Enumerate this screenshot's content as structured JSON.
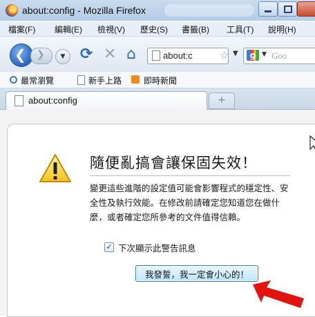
{
  "window": {
    "title": "about:config - Mozilla Firefox"
  },
  "menu": {
    "items": [
      "檔案(F)",
      "編輯(E)",
      "檢視(V)",
      "歷史(S)",
      "書籤(B)",
      "工具(T)",
      "說明(H)"
    ]
  },
  "navbar": {
    "url": "about:c",
    "search_placeholder": "Goo"
  },
  "bookmarks": {
    "items": [
      "最常瀏覽",
      "新手上路",
      "即時新聞"
    ]
  },
  "tab": {
    "label": "about:config",
    "new_tab": "+"
  },
  "warning": {
    "title": "隨便亂搞會讓保固失效！",
    "body": "變更這些進階的設定值可能會影響程式的穩定性、安全性及執行效能。在修改前請確定您知道您在做什麼，或者確定您所參考的文件值得信賴。",
    "checkbox_label": "下次顯示此警告訊息",
    "checkbox_checked": true,
    "confirm_button": "我發誓，我一定會小心的！"
  },
  "colors": {
    "accent_arrow": "#e3140f",
    "button_border": "#3c7fb1"
  },
  "icons": {
    "app": "firefox-icon",
    "warning": "warning-triangle-icon"
  }
}
